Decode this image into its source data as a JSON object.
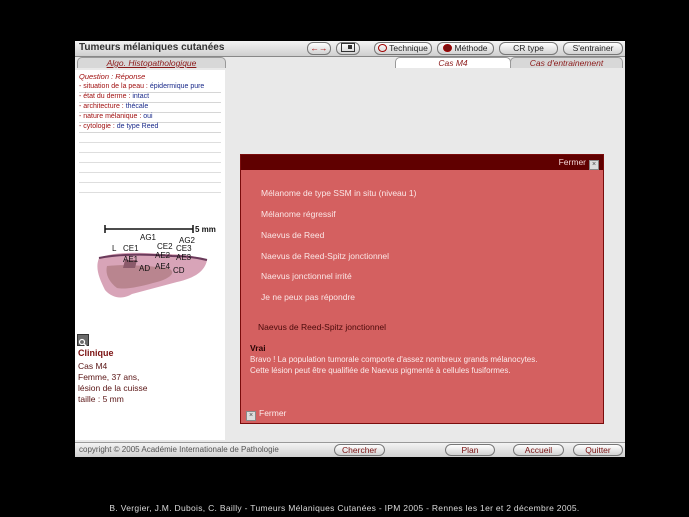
{
  "app": {
    "title": "Tumeurs mélaniques cutanées"
  },
  "toolbar": {
    "nav_icon": "arrows-icon",
    "view_icon": "slide-icon",
    "technique": "Technique",
    "methode": "Méthode",
    "cr_type": "CR type",
    "entrainer": "S'entrainer"
  },
  "tabs": [
    "Algo. Histopathologique",
    "Cas M4",
    "Cas d'entrainement"
  ],
  "question": {
    "header": "Question : Réponse",
    "rows": [
      {
        "key": "- situation de la peau :",
        "value": "épidermique pure"
      },
      {
        "key": "- état du derme :",
        "value": "intact"
      },
      {
        "key": "- architecture :",
        "value": "thécale"
      },
      {
        "key": "- nature mélanique :",
        "value": "oui"
      },
      {
        "key": "- cytologie :",
        "value": "de type Reed"
      }
    ]
  },
  "histology": {
    "scale": "5 mm",
    "labels": [
      "AG1",
      "AG2",
      "L",
      "CE1",
      "CE2",
      "CE3",
      "AE1",
      "AE2",
      "AE3",
      "AD",
      "AE4",
      "CD"
    ]
  },
  "clinique": {
    "title": "Clinique",
    "lines": [
      "Cas M4",
      "Femme, 37 ans,",
      "lésion de la cuisse",
      "taille : 5 mm"
    ]
  },
  "popup": {
    "close_top": "Fermer",
    "options": [
      "Mélanome de type SSM in situ (niveau 1)",
      "Mélanome régressif",
      "Naevus de Reed",
      "Naevus de Reed-Spitz jonctionnel",
      "Naevus jonctionnel irrité",
      "Je ne peux pas répondre"
    ],
    "selected": "Naevus de Reed-Spitz jonctionnel",
    "verdict": "Vrai",
    "explanation": [
      "Bravo ! La population tumorale comporte d'assez nombreux grands mélanocytes.",
      "Cette lésion peut être qualifiée de Naevus pigmenté à cellules fusiformes."
    ],
    "close_bottom": "Fermer"
  },
  "bottom": {
    "copyright": "copyright © 2005 Académie Internationale de Pathologie",
    "chercher": "Chercher",
    "plan": "Plan",
    "accueil": "Accueil",
    "quitter": "Quitter"
  },
  "footer": "B. Vergier, J.M. Dubois, C. Bailly - Tumeurs Mélaniques Cutanées - IPM 2005 - Rennes les 1er et 2 décembre 2005."
}
